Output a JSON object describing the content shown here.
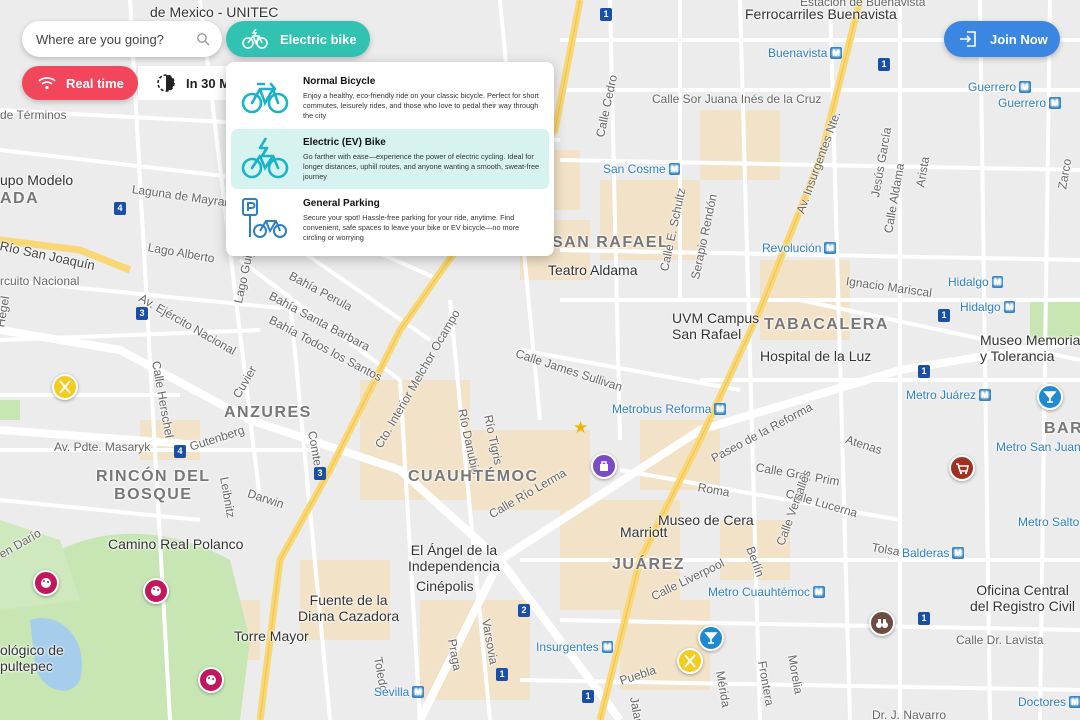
{
  "search": {
    "placeholder": "Where are you going?",
    "value": ""
  },
  "mode": {
    "label": "Electric bike",
    "accent": "#32c2b1"
  },
  "realtime": {
    "label": "Real time",
    "accent": "#f2465d"
  },
  "schedule": {
    "label": "In 30 M"
  },
  "join": {
    "label": "Join Now",
    "accent": "#3a86e0"
  },
  "dropdown": {
    "items": [
      {
        "title": "Normal Bicycle",
        "desc": "Enjoy a healthy, eco-friendly ride on your classic bicycle. Perfect for short commutes, leisurely rides, and those who love to pedal their way through the city",
        "icon": "bicycle-icon"
      },
      {
        "title": "Electric (EV) Bike",
        "desc": "Go farther with ease—experience the power of electric cycling. Ideal for longer distances, uphill routes, and anyone wanting a smooth, sweat-free journey",
        "icon": "electric-bike-icon",
        "selected": true
      },
      {
        "title": "General Parking",
        "desc": "Secure your spot! Hassle-free parking for your ride, anytime. Find convenient, safe spaces to leave your bike or EV bicycle—no more circling or worrying",
        "icon": "bike-parking-icon"
      }
    ]
  },
  "map": {
    "labels": {
      "mexico_unitec": "de Mexico - UNITEC",
      "ferrocarriles": "Ferrocarriles Buenavista",
      "estacion_buenavista": "Estación de Buenavista",
      "buenavista": "Buenavista",
      "terminos": "de Términos",
      "sor_juana": "Calle Sor Juana Inés de la Cruz",
      "guerrero1": "Guerrero",
      "guerrero2": "Guerrero",
      "grupo_modelo": "upo Modelo",
      "ada": "ADA",
      "laguna_mayran": "Laguna de Mayran",
      "calle_cedro": "Calle Cedro",
      "san_cosme": "San Cosme",
      "av_insurgentes_nte": "Av. Insurgentes Nte.",
      "jesus_garcia": "Jesús García",
      "calle_aldama": "Calle Aldama",
      "calle_arista": "Arista",
      "zarco": "Zarco",
      "rio_san_joaquin": "Río San Joaquín",
      "lago_alberto": "Lago Alberto",
      "san_rafael": "SAN RAFAEL",
      "schultz": "Calle E. Schultz",
      "serapio": "Serapio Rendón",
      "revolucion": "Revolución",
      "teatro_aldama": "Teatro Aldama",
      "ignacio_mariscal": "Ignacio Mariscal",
      "hidalgo1": "Hidalgo",
      "hidalgo2": "Hidalgo",
      "circuito_nacional": "rcuito Nacional",
      "bahia_perula": "Bahía Perula",
      "bahia_barbara": "Bahía Santa Barbara",
      "bahia_todos": "Bahía Todos los Santos",
      "melchor_ocampo": "Cto. Interior Melchor Ocampo",
      "lago_guija": "Lago Guija",
      "ejercito_nacional": "Av. Ejército Nacional",
      "uvm": "UVM Campus\nSan Rafael",
      "tabacalera": "TABACALERA",
      "hospital_luz": "Hospital de la Luz",
      "museo_memoria": "Museo Memoria\ny Tolerancia",
      "calle_hegel": "Hegel",
      "calle_herschel": "Calle Herschel",
      "cuvier": "Cuvier",
      "anzures": "ANZURES",
      "rio_danubio": "Río Danubio",
      "rio_tigris": "Río Tigris",
      "james_sullivan": "Calle James Sullivan",
      "metrobus_reforma": "Metrobus Reforma",
      "metro_juarez": "Metro Juárez",
      "bar": "BAR",
      "metro_san_juan": "Metro San Juan de",
      "pdte_masaryk": "Av. Pdte. Masaryk",
      "gutenberg": "Gutenberg",
      "leibnitz": "Leibnitz",
      "comte": "Comte",
      "paseo_reforma": "Paseo de la Reforma",
      "atenas": "Atenas",
      "rincon_bosque": "RINCÓN DEL\nBOSQUE",
      "darwin": "Darwin",
      "cuauhtemoc": "CUAUHTÉMOC",
      "rio_lerma": "Calle Río Lerma",
      "gral_prim": "Calle Gral. Prim",
      "roma": "Roma",
      "calle_lucerna": "Calle Lucerna",
      "metro_salto": "Metro Salto",
      "marriott": "Marriott",
      "museo_cera": "Museo de Cera",
      "tolsa": "Tolsa",
      "balderas": "Balderas",
      "camino_real": "Camino Real Polanco",
      "angel": "El Ángel de la\nIndependencia",
      "juarez": "JUÁREZ",
      "en_dario": "en Darío",
      "cinepolis": "Cinépolis",
      "calle_liverpool": "Calle Liverpool",
      "versalles": "Calle Versalles",
      "berlin": "Berlín",
      "oficina_civil": "Oficina Central\ndel Registro Civil",
      "fuente_diana": "Fuente de la\nDiana Cazadora",
      "metro_cuauhtemoc": "Metro Cuauhtémoc",
      "torre_mayor": "Torre Mayor",
      "dr_lavista": "Calle Dr. Lavista",
      "ologico": "ológico de\npultepec",
      "toledo": "Toledo",
      "praga": "Praga",
      "varsovia": "Varsovia",
      "insurgentes": "Insurgentes",
      "puebla": "Puebla",
      "merida": "Mérida",
      "frontera": "Frontera",
      "morelia": "Morelia",
      "jalapa": "Jalapa",
      "sevilla": "Sevilla",
      "doctores": "Doctores",
      "dr_navarro": "Dr. J. Navarro"
    }
  }
}
